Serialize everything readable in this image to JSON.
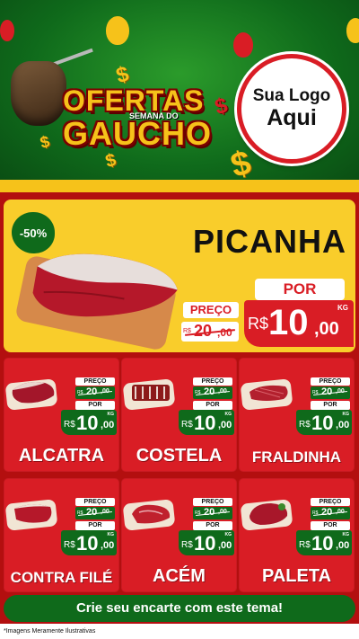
{
  "header": {
    "title_line1": "OFERTAS",
    "subtitle": "SEMANA DO",
    "title_line2": "GAUCHO",
    "logo_line1": "Sua Logo",
    "logo_line2": "Aqui"
  },
  "hero": {
    "discount": "-50%",
    "name": "PICANHA",
    "por_label": "POR",
    "preco_label": "PREÇO",
    "old_currency": "R$",
    "old_int": "20",
    "old_dec": ",00",
    "currency": "R$",
    "price_int": "10",
    "price_dec": ",00",
    "unit": "KG"
  },
  "products": [
    {
      "name": "ALCATRA",
      "preco_label": "PREÇO",
      "old_currency": "R$",
      "old_int": "20",
      "old_dec": ",00",
      "por_label": "POR",
      "currency": "R$",
      "price_int": "10",
      "price_dec": ",00",
      "unit": "KG"
    },
    {
      "name": "COSTELA",
      "preco_label": "PREÇO",
      "old_currency": "R$",
      "old_int": "20",
      "old_dec": ",00",
      "por_label": "POR",
      "currency": "R$",
      "price_int": "10",
      "price_dec": ",00",
      "unit": "KG"
    },
    {
      "name": "FRALDINHA",
      "preco_label": "PREÇO",
      "old_currency": "R$",
      "old_int": "20",
      "old_dec": ",00",
      "por_label": "POR",
      "currency": "R$",
      "price_int": "10",
      "price_dec": ",00",
      "unit": "KG"
    },
    {
      "name": "CONTRA FILÉ",
      "preco_label": "PREÇO",
      "old_currency": "R$",
      "old_int": "20",
      "old_dec": ",00",
      "por_label": "POR",
      "currency": "R$",
      "price_int": "10",
      "price_dec": ",00",
      "unit": "KG"
    },
    {
      "name": "ACÉM",
      "preco_label": "PREÇO",
      "old_currency": "R$",
      "old_int": "20",
      "old_dec": ",00",
      "por_label": "POR",
      "currency": "R$",
      "price_int": "10",
      "price_dec": ",00",
      "unit": "KG"
    },
    {
      "name": "PALETA",
      "preco_label": "PREÇO",
      "old_currency": "R$",
      "old_int": "20",
      "old_dec": ",00",
      "por_label": "POR",
      "currency": "R$",
      "price_int": "10",
      "price_dec": ",00",
      "unit": "KG"
    }
  ],
  "footer": {
    "cta": "Crie seu encarte com este tema!",
    "disclaimer": "*Imagens Meramente Ilustrativas"
  },
  "colors": {
    "green": "#0f6a1b",
    "red": "#d91d25",
    "yellow": "#f6c21a"
  },
  "icons": [
    "mate-gourd-icon",
    "balloon-icon",
    "money-icon",
    "meat-icon"
  ]
}
